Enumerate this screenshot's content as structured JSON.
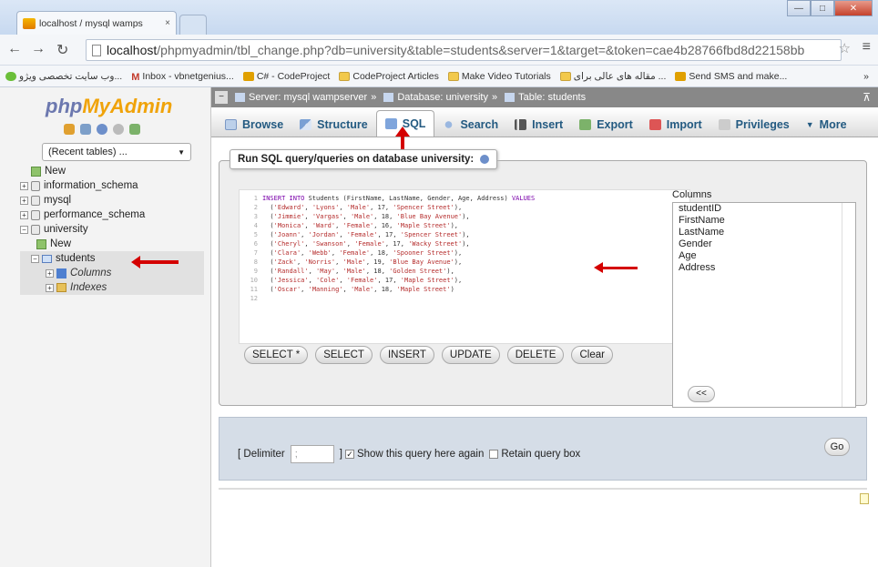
{
  "browser": {
    "tab_title": "localhost / mysql wamps",
    "tab_close": "×",
    "url_host": "localhost",
    "url_path": "/phpmyadmin/tbl_change.php?db=university&table=students&server=1&target=&token=cae4b28766fbd8d22158bb",
    "bookmarks": [
      {
        "label": "وب سایت تخصصی ویژو...",
        "icon": "green-site-icon"
      },
      {
        "label": "Inbox - vbnetgenius...",
        "icon": "gmail-icon"
      },
      {
        "label": "C# - CodeProject",
        "icon": "codeproject-icon"
      },
      {
        "label": "CodeProject Articles",
        "icon": "folder-icon"
      },
      {
        "label": "Make Video Tutorials",
        "icon": "folder-icon"
      },
      {
        "label": "مقاله های عالی برای ...",
        "icon": "folder-icon"
      },
      {
        "label": "Send SMS and make...",
        "icon": "sms-icon"
      }
    ],
    "bookmarks_more": "»"
  },
  "sidebar": {
    "logo_php": "php",
    "logo_myadmin": "MyAdmin",
    "recent_tables": "(Recent tables) ...",
    "tree": [
      {
        "label": "New",
        "level": 0
      },
      {
        "label": "information_schema",
        "level": 0
      },
      {
        "label": "mysql",
        "level": 0
      },
      {
        "label": "performance_schema",
        "level": 0
      },
      {
        "label": "university",
        "level": 0
      },
      {
        "label": "New",
        "level": 1
      },
      {
        "label": "students",
        "level": 1
      },
      {
        "label": "Columns",
        "level": 2
      },
      {
        "label": "Indexes",
        "level": 2
      }
    ]
  },
  "breadcrumb": {
    "server": "Server: mysql wampserver",
    "database": "Database: university",
    "table": "Table: students",
    "sep": "»"
  },
  "tabs": [
    "Browse",
    "Structure",
    "SQL",
    "Search",
    "Insert",
    "Export",
    "Import",
    "Privileges",
    "More"
  ],
  "active_tab": "SQL",
  "sql": {
    "legend": "Run SQL query/queries on database university:",
    "lines": [
      "INSERT INTO Students (FirstName, LastName, Gender, Age, Address) VALUES",
      "  ('Edward', 'Lyons', 'Male', 17, 'Spencer Street'),",
      "  ('Jimmie', 'Vargas', 'Male', 18, 'Blue Bay Avenue'),",
      "  ('Monica', 'Ward', 'Female', 16, 'Maple Street'),",
      "  ('Joann', 'Jordan', 'Female', 17, 'Spencer Street'),",
      "  ('Cheryl', 'Swanson', 'Female', 17, 'Wacky Street'),",
      "  ('Clara', 'Webb', 'Female', 18, 'Spooner Street'),",
      "  ('Zack', 'Norris', 'Male', 19, 'Blue Bay Avenue'),",
      "  ('Randall', 'May', 'Male', 18, 'Golden Street'),",
      "  ('Jessica', 'Cole', 'Female', 17, 'Maple Street'),",
      "  ('Oscar', 'Manning', 'Male', 18, 'Maple Street')",
      ""
    ],
    "buttons": [
      "SELECT *",
      "SELECT",
      "INSERT",
      "UPDATE",
      "DELETE",
      "Clear"
    ],
    "columns_label": "Columns",
    "columns": [
      "studentID",
      "FirstName",
      "LastName",
      "Gender",
      "Age",
      "Address"
    ],
    "insert_col_button": "<<"
  },
  "options": {
    "delimiter_label_open": "[ Delimiter",
    "delimiter_value": ";",
    "delimiter_label_close": "]",
    "show_query_label": "Show this query here again",
    "retain_label": "Retain query box",
    "go": "Go"
  }
}
